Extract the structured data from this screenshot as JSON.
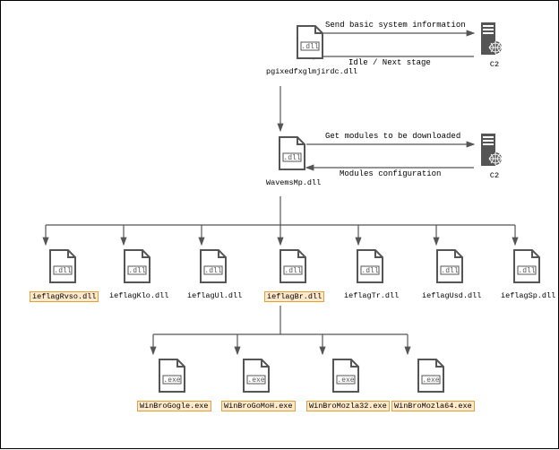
{
  "stage1": {
    "filename": "pgixedfxglmjirdc.dll",
    "ext": ".dll",
    "comm_send": "Send basic system information",
    "comm_recv": "Idle / Next stage",
    "c2_label": "C2"
  },
  "stage2": {
    "filename": "WavemsMp.dll",
    "ext": ".dll",
    "comm_send": "Get modules to be downloaded",
    "comm_recv": "Modules configuration",
    "c2_label": "C2"
  },
  "modules": [
    {
      "name": "ieflagRvso.dll",
      "ext": ".dll",
      "highlighted": true
    },
    {
      "name": "ieflagKlo.dll",
      "ext": ".dll",
      "highlighted": false
    },
    {
      "name": "ieflagUl.dll",
      "ext": ".dll",
      "highlighted": false
    },
    {
      "name": "ieflagBr.dll",
      "ext": ".dll",
      "highlighted": true
    },
    {
      "name": "ieflagTr.dll",
      "ext": ".dll",
      "highlighted": false
    },
    {
      "name": "ieflagUsd.dll",
      "ext": ".dll",
      "highlighted": false
    },
    {
      "name": "ieflagSp.dll",
      "ext": ".dll",
      "highlighted": false
    }
  ],
  "executables": [
    {
      "name": "WinBroGogle.exe",
      "ext": ".exe"
    },
    {
      "name": "WinBroGoMoH.exe",
      "ext": ".exe"
    },
    {
      "name": "WinBroMozla32.exe",
      "ext": ".exe"
    },
    {
      "name": "WinBroMozla64.exe",
      "ext": ".exe"
    }
  ]
}
